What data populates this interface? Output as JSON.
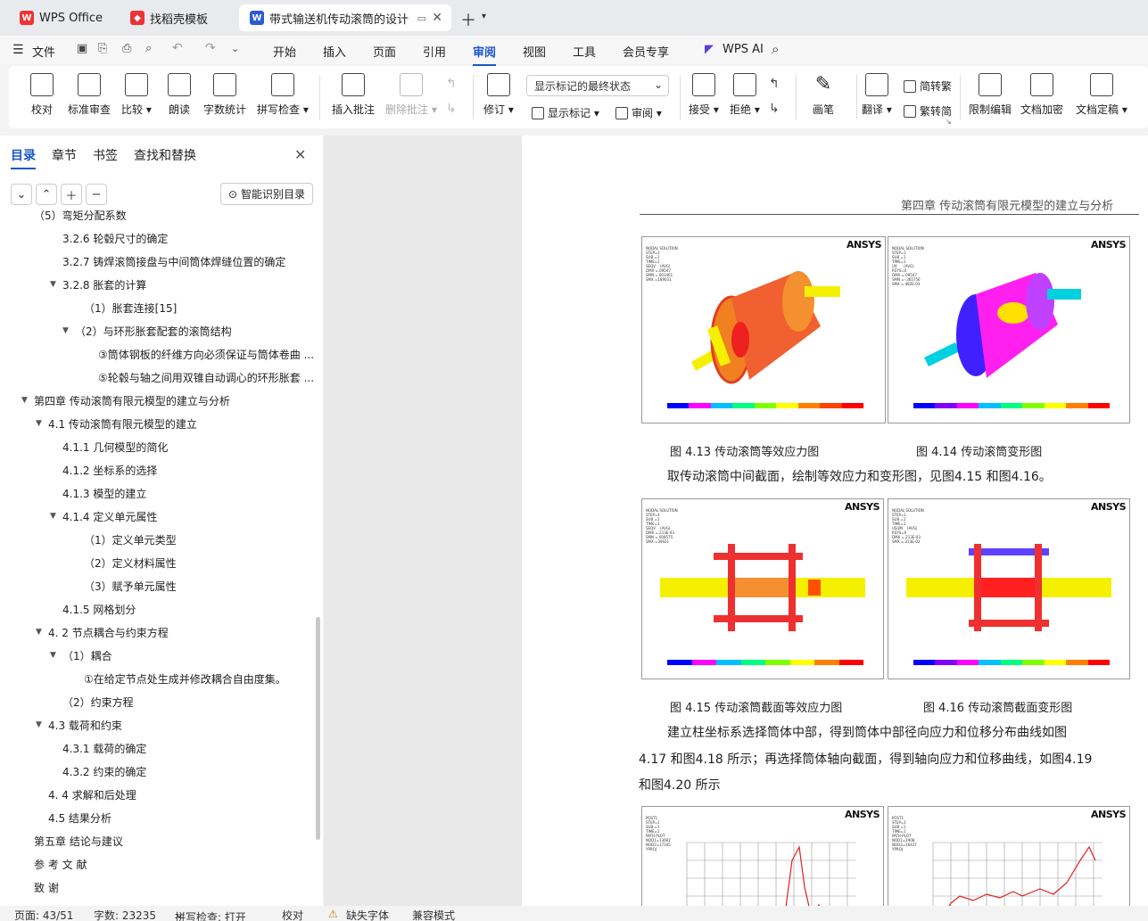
{
  "tabs": [
    {
      "label": "WPS Office"
    },
    {
      "label": "找稻壳模板"
    },
    {
      "label": "带式输送机传动滚筒的设计 说"
    }
  ],
  "menu": {
    "file": "文件",
    "items": [
      "开始",
      "插入",
      "页面",
      "引用",
      "审阅",
      "视图",
      "工具",
      "会员专享"
    ],
    "ai": "WPS AI",
    "active": "审阅"
  },
  "ribbon": {
    "proof": "校对",
    "std": "标准审查",
    "compare": "比较",
    "read": "朗读",
    "wordcount": "字数统计",
    "spell": "拼写检查",
    "insert_comment": "插入批注",
    "delete_comment": "删除批注",
    "revise": "修订",
    "display_select": "显示标记的最终状态",
    "show_marks": "显示标记",
    "review": "审阅",
    "accept": "接受",
    "reject": "拒绝",
    "pen": "画笔",
    "translate": "翻译",
    "s2t": "简转繁",
    "t2s": "繁转简",
    "restrict": "限制编辑",
    "encrypt": "文档加密",
    "finalize": "文档定稿"
  },
  "leftpane": {
    "tabs": [
      "目录",
      "章节",
      "书签",
      "查找和替换"
    ],
    "smart": "智能识别目录",
    "toc": [
      {
        "label": "（5）弯矩分配系数",
        "level": 3,
        "arrow": ""
      },
      {
        "label": "3.2.6  轮毂尺寸的确定",
        "level": 2,
        "arrow": ""
      },
      {
        "label": "3.2.7  铸焊滚筒接盘与中间筒体焊缝位置的确定",
        "level": 2,
        "arrow": ""
      },
      {
        "label": "3.2.8  胀套的计算",
        "level": 2,
        "arrow": "▼"
      },
      {
        "label": "（1）胀套连接[15]",
        "level": 3,
        "arrow": ""
      },
      {
        "label": "（2）与环形胀套配套的滚筒结构",
        "level": 3,
        "arrow": "▼"
      },
      {
        "label": "③筒体钢板的纤维方向必须保证与筒体卷曲 ...",
        "level": 4,
        "arrow": ""
      },
      {
        "label": "⑤轮毂与轴之间用双锥自动调心的环形胀套 ...",
        "level": 4,
        "arrow": ""
      },
      {
        "label": "第四章  传动滚筒有限元模型的建立与分析",
        "level": 0,
        "arrow": "▼"
      },
      {
        "label": "4.1  传动滚筒有限元模型的建立",
        "level": 1,
        "arrow": "▼"
      },
      {
        "label": "4.1.1  几何模型的简化",
        "level": 2,
        "arrow": ""
      },
      {
        "label": "4.1.2  坐标系的选择",
        "level": 2,
        "arrow": ""
      },
      {
        "label": "4.1.3  模型的建立",
        "level": 2,
        "arrow": ""
      },
      {
        "label": "4.1.4  定义单元属性",
        "level": 2,
        "arrow": "▼"
      },
      {
        "label": "（1）定义单元类型",
        "level": 3,
        "arrow": ""
      },
      {
        "label": "（2）定义材料属性",
        "level": 3,
        "arrow": ""
      },
      {
        "label": "（3）赋予单元属性",
        "level": 3,
        "arrow": ""
      },
      {
        "label": "4.1.5  网格划分",
        "level": 2,
        "arrow": ""
      },
      {
        "label": "4. 2  节点耦合与约束方程",
        "level": 1,
        "arrow": "▼"
      },
      {
        "label": "（1）耦合",
        "level": 2,
        "arrow": "▼"
      },
      {
        "label": "①在给定节点处生成并修改耦合自由度集。",
        "level": 3,
        "arrow": ""
      },
      {
        "label": "（2）约束方程",
        "level": 2,
        "arrow": ""
      },
      {
        "label": "4.3  载荷和约束",
        "level": 1,
        "arrow": "▼"
      },
      {
        "label": "4.3.1  载荷的确定",
        "level": 2,
        "arrow": ""
      },
      {
        "label": "4.3.2  约束的确定",
        "level": 2,
        "arrow": ""
      },
      {
        "label": "4. 4  求解和后处理",
        "level": 1,
        "arrow": ""
      },
      {
        "label": "4.5  结果分析",
        "level": 1,
        "arrow": ""
      },
      {
        "label": "第五章  结论与建议",
        "level": 0,
        "arrow": ""
      },
      {
        "label": "参 考 文 献",
        "level": 0,
        "arrow": ""
      },
      {
        "label": "致    谢",
        "level": 0,
        "arrow": ""
      }
    ]
  },
  "doc": {
    "header": "第四章  传动滚筒有限元模型的建立与分析",
    "ansys": "ANSYS",
    "fig_text": {
      "f413": "NODAL SOLUTION\nSTEP=1\nSUB =1\nTIME=1\nSEQV    (AVG)\nDMX =.09547\nSMN =.001401\nSMX =189031",
      "f414": "NODAL SOLUTION\nSTEP=1\nSUB =1\nTIME=1\nUX      (AVG)\nRSYS=0\nDMX =.09547\nSMN =-.365756\nSMX =.482E-03",
      "f415": "NODAL SOLUTION\nSTEP=1\nSUB =1\nTIME=1\nSEQV    (AVG)\nDMX =.213E-03\nSMN =.008575\nSMX =30921",
      "f416": "NODAL SOLUTION\nSTEP=1\nSUB =1\nTIME=1\nUSUM    (AVG)\nRSYS=0\nDMX =.213E-03\nSMX =.213E-03",
      "f417": "POST1\nSTEP=1\nSUB =1\nTIME=1\nPATH PLOT\nNOD1=13602\nNOD2=17105\nYPROJ",
      "f418": "POST1\nSTEP=1\nSUB =1\nTIME=1\nPATH PLOT\nNOD1=2908\nNOD2=16437\nYPROJ"
    },
    "cap_413": "图  4.13  传动滚筒等效应力图",
    "cap_414": "图  4.14  传动滚筒变形图",
    "para1": "取传动滚筒中间截面，绘制等效应力和变形图，见图4.15  和图4.16。",
    "cap_415": "图  4.15  传动滚筒截面等效应力图",
    "cap_416": "图  4.16  传动滚筒截面变形图",
    "para2a": "建立柱坐标系选择筒体中部，得到筒体中部径向应力和位移分布曲线如图",
    "para2b": "4.17  和图4.18  所示；再选择筒体轴向截面，得到轴向应力和位移曲线，如图4.19",
    "para2c": "和图4.20  所示"
  },
  "status": {
    "page": "页面: 43/51",
    "words": "字数: 23235",
    "spell": "拼写检查: 打开",
    "proof": "校对",
    "font": "缺失字体",
    "compat": "兼容模式"
  }
}
